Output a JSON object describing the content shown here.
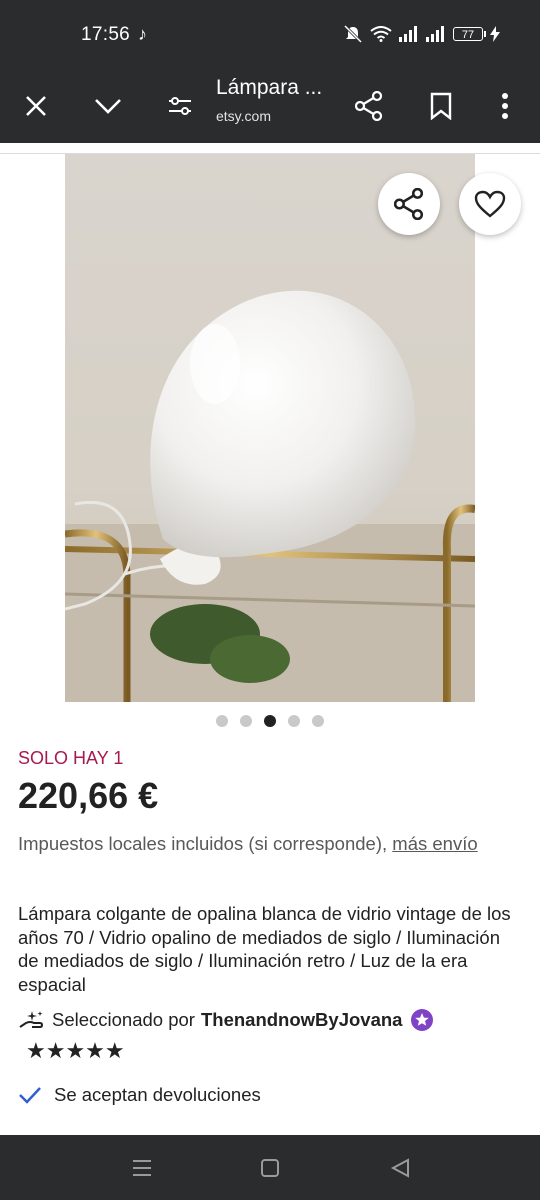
{
  "status": {
    "time": "17:56",
    "battery": "77",
    "icons": [
      "tiktok-icon",
      "mute-icon",
      "wifi-icon",
      "signal-icon",
      "battery-icon",
      "charging-icon"
    ]
  },
  "toolbar": {
    "title": "Lámpara ...",
    "url": "etsy.com",
    "icons": [
      "close-icon",
      "chevron-down-icon",
      "settings-sliders-icon",
      "share-icon",
      "bookmark-icon",
      "more-vertical-icon"
    ]
  },
  "gallery": {
    "page_count": 5,
    "active_index": 3,
    "icons": [
      "share-icon",
      "heart-icon"
    ]
  },
  "listing": {
    "stock": "SOLO HAY 1",
    "price": "220,66 €",
    "tax_text": "Impuestos locales incluidos (si corresponde), ",
    "tax_link": "más envío",
    "title": "Lámpara colgante de opalina blanca de vidrio vintage de los años 70 / Vidrio opalino de mediados de siglo / Iluminación de mediados de siglo / Iluminación retro / Luz de la era espacial",
    "picked_prefix": "Seleccionado por",
    "shop_name": "ThenandnowByJovana",
    "stars": "★★★★★",
    "rating": 5,
    "returns": "Se aceptan devoluciones"
  },
  "colors": {
    "toolbar_bg": "#2b2c2e",
    "stock_red": "#a61a4f",
    "star_badge": "#7f43c5",
    "check_blue": "#2f5fd0"
  },
  "navigation": {
    "icons": [
      "recents-icon",
      "home-icon",
      "back-icon"
    ]
  }
}
